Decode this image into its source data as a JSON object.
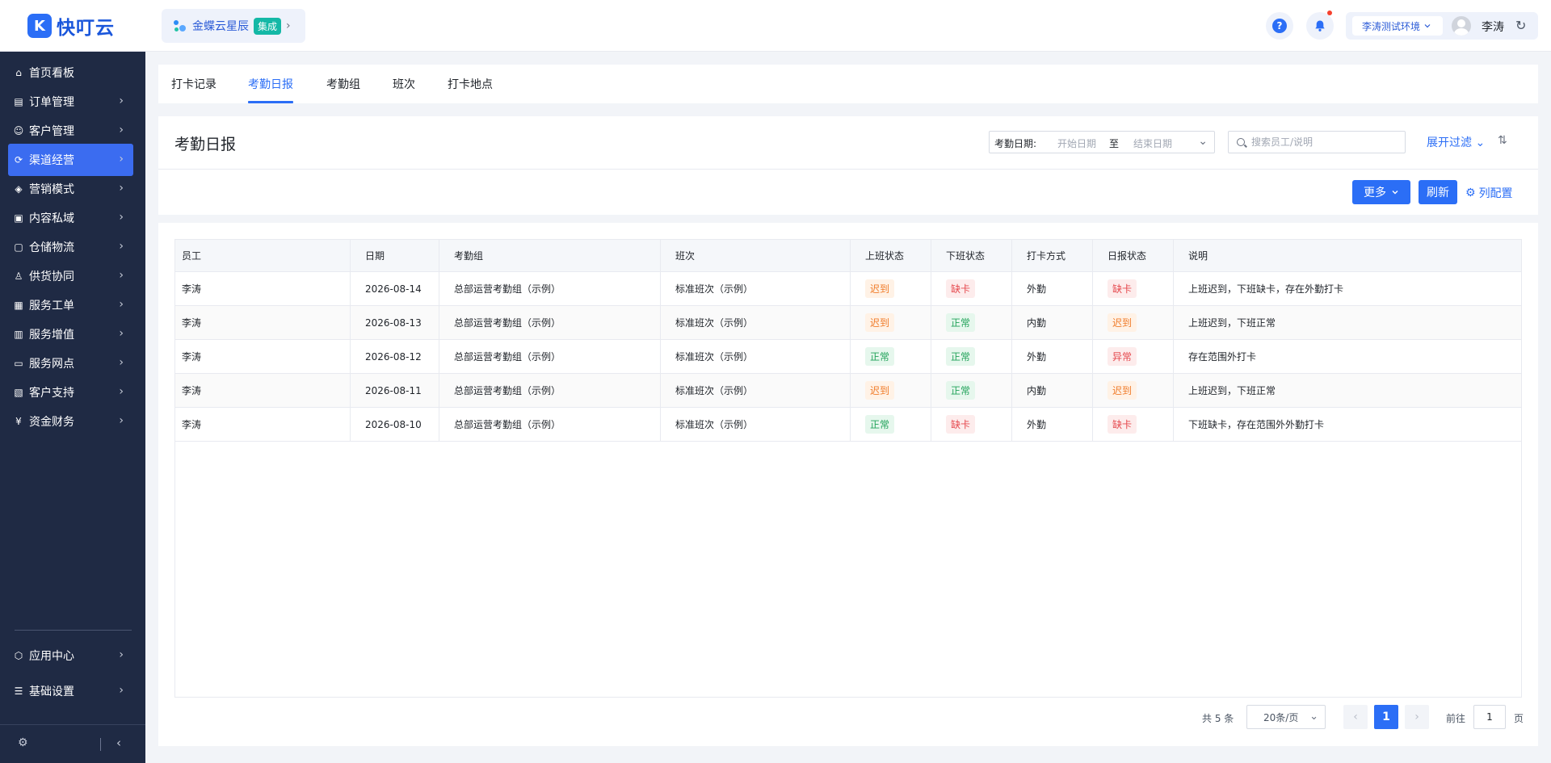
{
  "header": {
    "logo_mark": "K",
    "logo_text": "快叮云",
    "integration": {
      "name": "金蝶云星辰",
      "badge": "集成",
      "arrow": "›"
    },
    "help_icon": "?",
    "environment": "李涛测试环境",
    "user_name": "李涛"
  },
  "sidebar": {
    "items": [
      {
        "label": "首页看板",
        "icon": "home-icon",
        "has_children": false,
        "active": false
      },
      {
        "label": "订单管理",
        "icon": "order-icon",
        "has_children": true,
        "active": false
      },
      {
        "label": "客户管理",
        "icon": "user-icon",
        "has_children": true,
        "active": false
      },
      {
        "label": "渠道经营",
        "icon": "channel-icon",
        "has_children": true,
        "active": true
      },
      {
        "label": "营销模式",
        "icon": "tag-icon",
        "has_children": true,
        "active": false
      },
      {
        "label": "内容私域",
        "icon": "image-icon",
        "has_children": true,
        "active": false
      },
      {
        "label": "仓储物流",
        "icon": "warehouse-icon",
        "has_children": true,
        "active": false
      },
      {
        "label": "供货协同",
        "icon": "supply-icon",
        "has_children": true,
        "active": false
      },
      {
        "label": "服务工单",
        "icon": "ticket-icon",
        "has_children": true,
        "active": false
      },
      {
        "label": "服务增值",
        "icon": "bag-icon",
        "has_children": true,
        "active": false
      },
      {
        "label": "服务网点",
        "icon": "store-icon",
        "has_children": true,
        "active": false
      },
      {
        "label": "客户支持",
        "icon": "support-icon",
        "has_children": true,
        "active": false
      },
      {
        "label": "资金财务",
        "icon": "yuan-icon",
        "has_children": true,
        "active": false
      }
    ],
    "bottom_items": [
      {
        "label": "应用中心",
        "icon": "cube-icon"
      },
      {
        "label": "基础设置",
        "icon": "settings-list-icon"
      }
    ]
  },
  "tabs": [
    {
      "label": "打卡记录",
      "active": false
    },
    {
      "label": "考勤日报",
      "active": true
    },
    {
      "label": "考勤组",
      "active": false
    },
    {
      "label": "班次",
      "active": false
    },
    {
      "label": "打卡地点",
      "active": false
    }
  ],
  "toolbar": {
    "title": "考勤日报",
    "date_label": "考勤日期:",
    "date_start_placeholder": "开始日期",
    "date_separator": "至",
    "date_end_placeholder": "结束日期",
    "search_placeholder": "搜索员工/说明",
    "expand_filter": "展开过滤",
    "more_label": "更多",
    "refresh_label": "刷新",
    "column_config": "列配置"
  },
  "table": {
    "columns": [
      "员工",
      "日期",
      "考勤组",
      "班次",
      "上班状态",
      "下班状态",
      "打卡方式",
      "日报状态",
      "说明"
    ],
    "rows": [
      {
        "employee": "李涛",
        "date": "2026-08-14",
        "group": "总部运营考勤组（示例）",
        "shift": "标准班次（示例）",
        "in_status": "迟到",
        "in_type": "late",
        "out_status": "缺卡",
        "out_type": "missing",
        "method": "外勤",
        "report": "缺卡",
        "report_type": "missing",
        "note": "上班迟到，下班缺卡，存在外勤打卡"
      },
      {
        "employee": "李涛",
        "date": "2026-08-13",
        "group": "总部运营考勤组（示例）",
        "shift": "标准班次（示例）",
        "in_status": "迟到",
        "in_type": "late",
        "out_status": "正常",
        "out_type": "normal",
        "method": "内勤",
        "report": "迟到",
        "report_type": "late",
        "note": "上班迟到，下班正常"
      },
      {
        "employee": "李涛",
        "date": "2026-08-12",
        "group": "总部运营考勤组（示例）",
        "shift": "标准班次（示例）",
        "in_status": "正常",
        "in_type": "normal",
        "out_status": "正常",
        "out_type": "normal",
        "method": "外勤",
        "report": "异常",
        "report_type": "abnormal",
        "note": "存在范围外打卡"
      },
      {
        "employee": "李涛",
        "date": "2026-08-11",
        "group": "总部运营考勤组（示例）",
        "shift": "标准班次（示例）",
        "in_status": "迟到",
        "in_type": "late",
        "out_status": "正常",
        "out_type": "normal",
        "method": "内勤",
        "report": "迟到",
        "report_type": "late",
        "note": "上班迟到，下班正常"
      },
      {
        "employee": "李涛",
        "date": "2026-08-10",
        "group": "总部运营考勤组（示例）",
        "shift": "标准班次（示例）",
        "in_status": "正常",
        "in_type": "normal",
        "out_status": "缺卡",
        "out_type": "missing",
        "method": "外勤",
        "report": "缺卡",
        "report_type": "missing",
        "note": "下班缺卡，存在范围外外勤打卡"
      }
    ]
  },
  "pagination": {
    "total": "共 5 条",
    "page_size": "20条/页",
    "current_page": "1",
    "goto_label": "前往",
    "goto_value": "1",
    "page_unit": "页"
  },
  "colors": {
    "primary": "#2b6ef6",
    "sidebar_bg": "#1f2a44",
    "late": "#f07c2a",
    "missing": "#e5484d",
    "normal": "#22a35a"
  }
}
